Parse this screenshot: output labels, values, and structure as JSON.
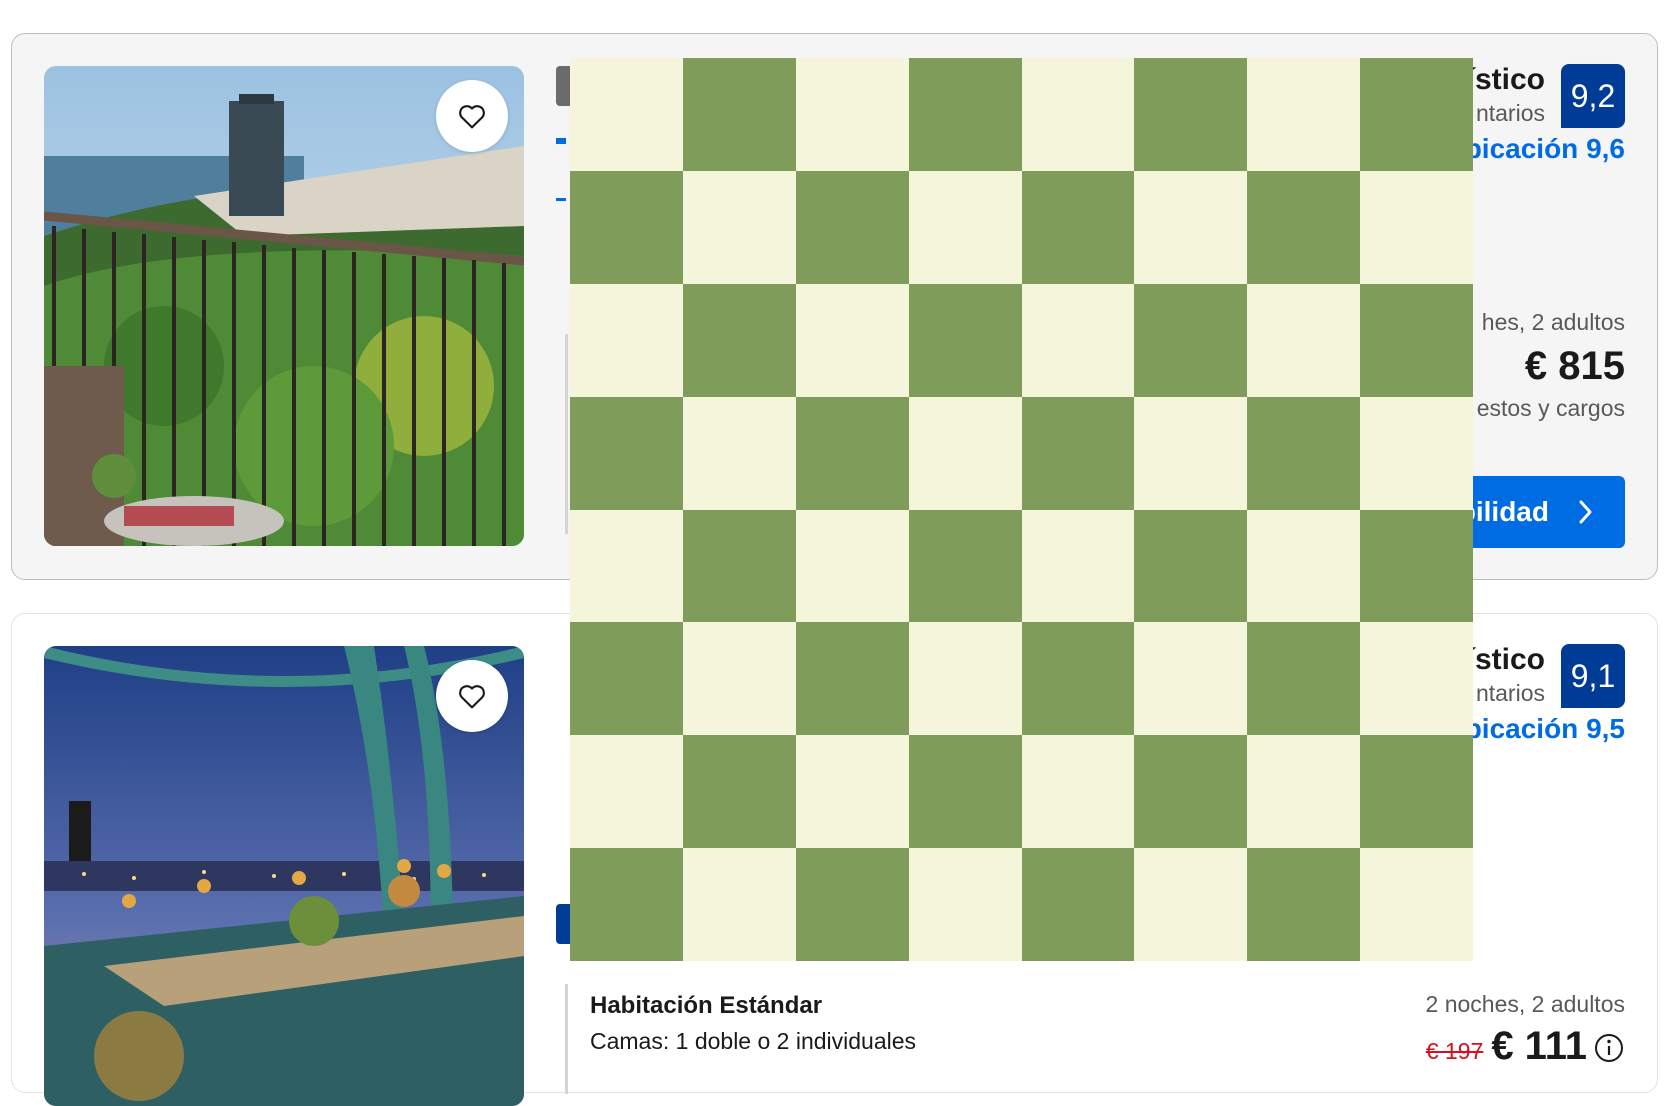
{
  "overlay": {
    "rows": 8,
    "cols": 8,
    "light_color": "#f5f5dc",
    "dark_color": "#7f9c5a"
  },
  "colors": {
    "brand_blue": "#003b95",
    "link_blue": "#006ce4",
    "discount_red": "#d4111e"
  },
  "cards": [
    {
      "favorite_icon": "heart-outline-icon",
      "score_word": "ístico",
      "score_sub": "ntarios",
      "score": "9,2",
      "location": "bicación 9,6",
      "stay": "hes, 2 adultos",
      "price": "€ 815",
      "taxes": "estos y cargos",
      "button": "bilidad",
      "button_icon": "chevron-right-icon"
    },
    {
      "favorite_icon": "heart-outline-icon",
      "score_word": "ístico",
      "score_sub": "ntarios",
      "score": "9,1",
      "location": "bicación 9,5",
      "room_title": "Habitación Estándar",
      "room_beds": "Camas: 1 doble o 2 individuales",
      "stay": "2 noches, 2 adultos",
      "old_price": "€ 197",
      "price": "€ 111",
      "info_icon": "info-icon"
    }
  ]
}
